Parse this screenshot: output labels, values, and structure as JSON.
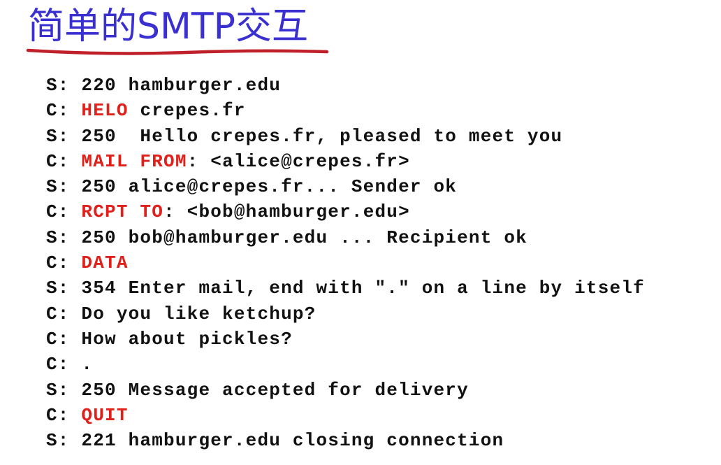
{
  "title": "简单的SMTP交互",
  "colors": {
    "title": "#3a2fd0",
    "underline": "#c0202a",
    "command": "#e0201b",
    "text": "#111111"
  },
  "lines": [
    {
      "prefix": "S: ",
      "segments": [
        {
          "text": "220 hamburger.edu"
        }
      ]
    },
    {
      "prefix": "C: ",
      "segments": [
        {
          "text": "HELO",
          "cmd": true
        },
        {
          "text": " crepes.fr"
        }
      ]
    },
    {
      "prefix": "S: ",
      "segments": [
        {
          "text": "250  Hello crepes.fr, pleased to meet you"
        }
      ]
    },
    {
      "prefix": "C: ",
      "segments": [
        {
          "text": "MAIL FROM",
          "cmd": true
        },
        {
          "text": ": <alice@crepes.fr>"
        }
      ]
    },
    {
      "prefix": "S: ",
      "segments": [
        {
          "text": "250 alice@crepes.fr... Sender ok"
        }
      ]
    },
    {
      "prefix": "C: ",
      "segments": [
        {
          "text": "RCPT TO",
          "cmd": true
        },
        {
          "text": ": <bob@hamburger.edu>"
        }
      ]
    },
    {
      "prefix": "S: ",
      "segments": [
        {
          "text": "250 bob@hamburger.edu ... Recipient ok"
        }
      ]
    },
    {
      "prefix": "C: ",
      "segments": [
        {
          "text": "DATA",
          "cmd": true
        }
      ]
    },
    {
      "prefix": "S: ",
      "segments": [
        {
          "text": "354 Enter mail, end with \".\" on a line by itself"
        }
      ]
    },
    {
      "prefix": "C: ",
      "segments": [
        {
          "text": "Do you like ketchup?"
        }
      ]
    },
    {
      "prefix": "C: ",
      "segments": [
        {
          "text": "How about pickles?"
        }
      ]
    },
    {
      "prefix": "C: ",
      "segments": [
        {
          "text": "."
        }
      ]
    },
    {
      "prefix": "S: ",
      "segments": [
        {
          "text": "250 Message accepted for delivery"
        }
      ]
    },
    {
      "prefix": "C: ",
      "segments": [
        {
          "text": "QUIT",
          "cmd": true
        }
      ]
    },
    {
      "prefix": "S: ",
      "segments": [
        {
          "text": "221 hamburger.edu closing connection"
        }
      ]
    }
  ]
}
